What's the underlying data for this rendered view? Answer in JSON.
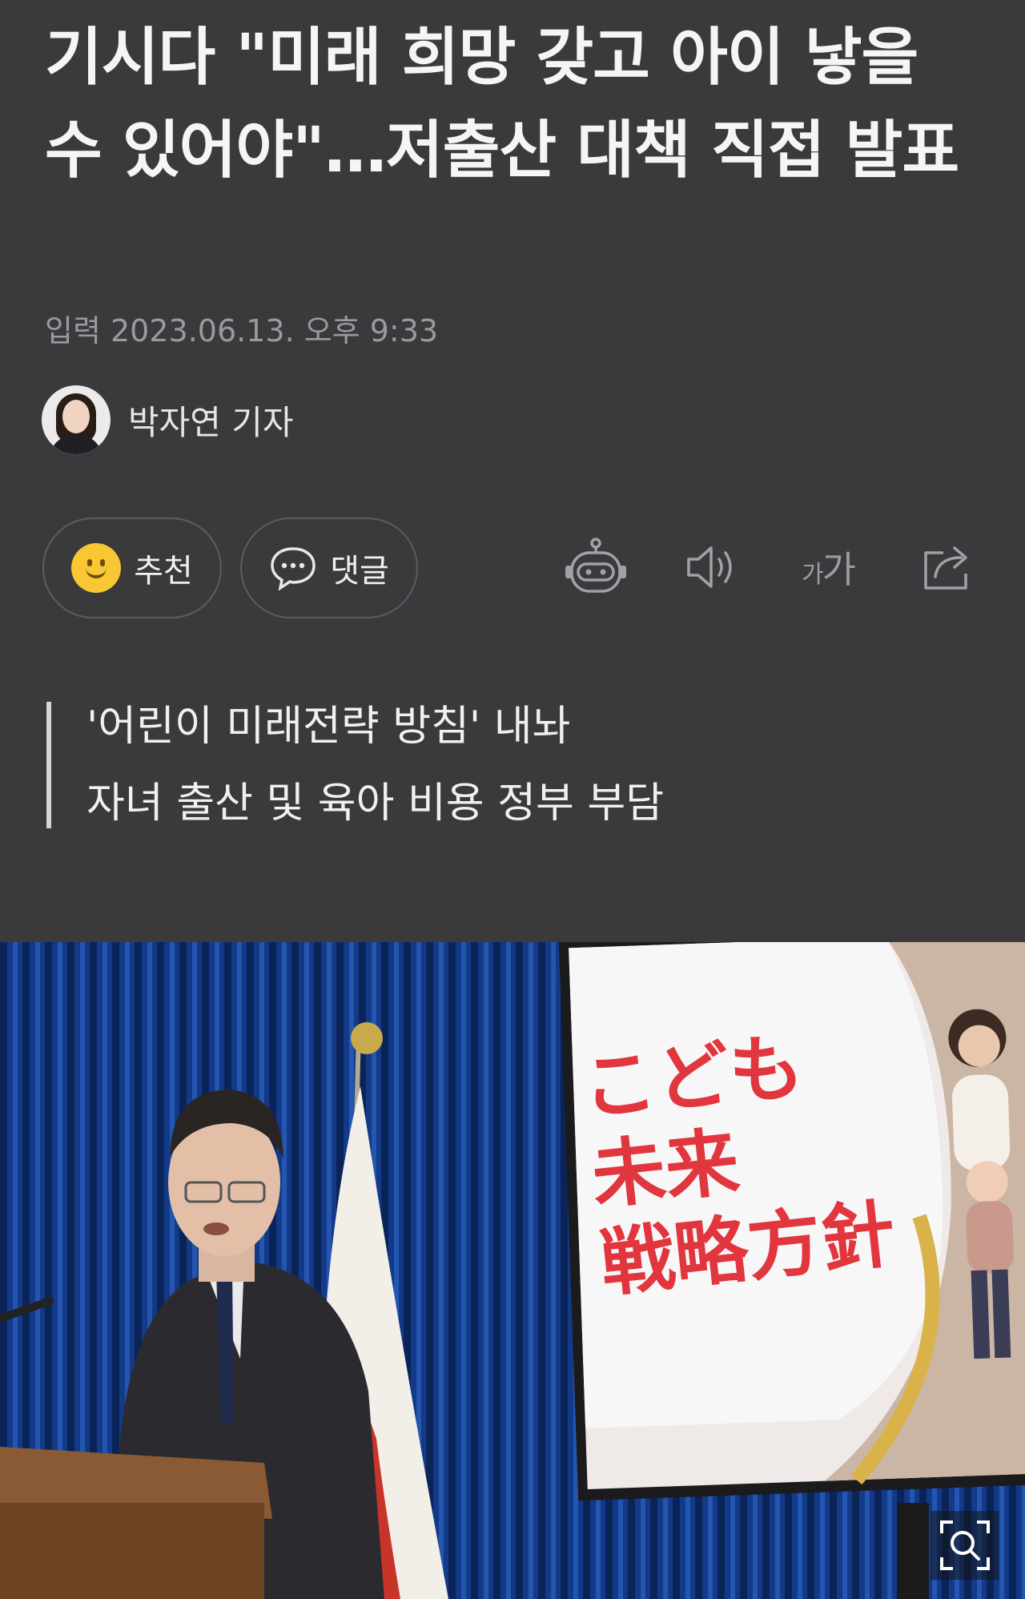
{
  "article": {
    "title": "기시다 \"미래 희망 갖고 아이 낳을 수 있어야\"…저출산 대책 직접 발표",
    "meta": "입력 2023.06.13. 오후 9:33",
    "author": "박자연 기자"
  },
  "actions": {
    "recommend_label": "추천",
    "comment_label": "댓글",
    "font_label_small": "가",
    "font_label_large": "가",
    "icons": [
      "smiley-icon",
      "comment-icon",
      "robot-icon",
      "speaker-icon",
      "font-size-icon",
      "share-icon",
      "zoom-icon"
    ]
  },
  "summary": [
    "'어린이 미래전략 방침' 내놔",
    "자녀 출산 및 육아 비용 정부 부담"
  ],
  "photo": {
    "screen_text": [
      "こども",
      "未来",
      "戦略方針"
    ]
  },
  "colors": {
    "background": "#3a3a3d",
    "accent_yellow": "#f8c733",
    "muted_text": "#9a9a9e",
    "screen_text": "#e2363f"
  }
}
